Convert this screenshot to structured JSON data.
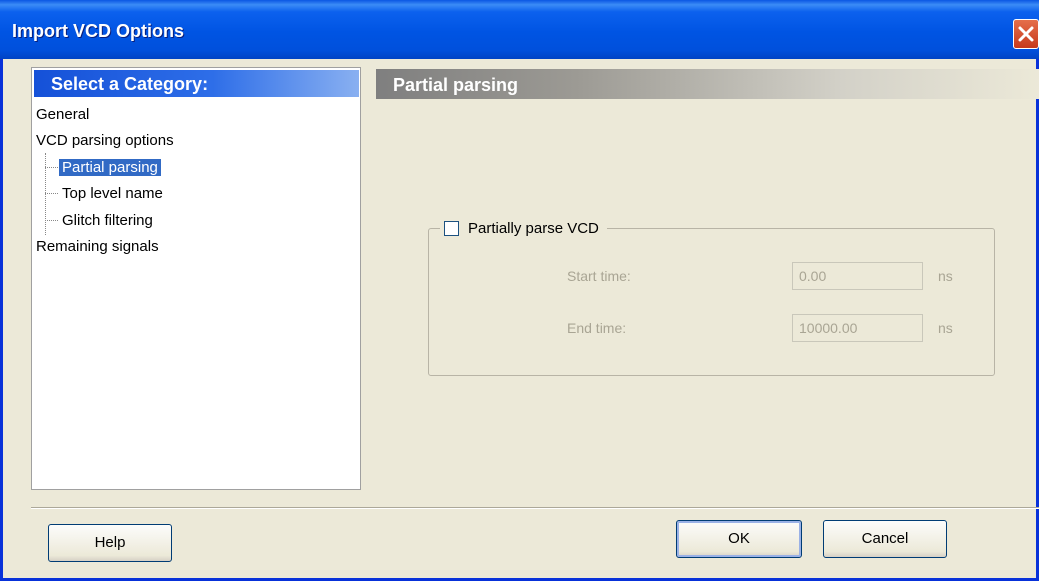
{
  "window": {
    "title": "Import VCD Options"
  },
  "left_pane": {
    "header": "Select a Category:",
    "tree": [
      {
        "label": "General"
      },
      {
        "label": "VCD parsing options"
      },
      {
        "label": "Partial parsing",
        "selected": true
      },
      {
        "label": "Top level name"
      },
      {
        "label": "Glitch filtering"
      },
      {
        "label": "Remaining signals"
      }
    ]
  },
  "right_pane": {
    "header": "Partial parsing",
    "group": {
      "checkbox_label": "Partially parse VCD",
      "checked": false,
      "start_time": {
        "label": "Start time:",
        "value": "0.00",
        "unit": "ns"
      },
      "end_time": {
        "label": "End time:",
        "value": "10000.00",
        "unit": "ns"
      }
    }
  },
  "buttons": {
    "help": "Help",
    "ok": "OK",
    "cancel": "Cancel"
  },
  "colors": {
    "title_blue": "#0054e3",
    "selection": "#316ac5",
    "dialog_bg": "#ece9d8"
  },
  "icons": {
    "close": "close-icon"
  }
}
